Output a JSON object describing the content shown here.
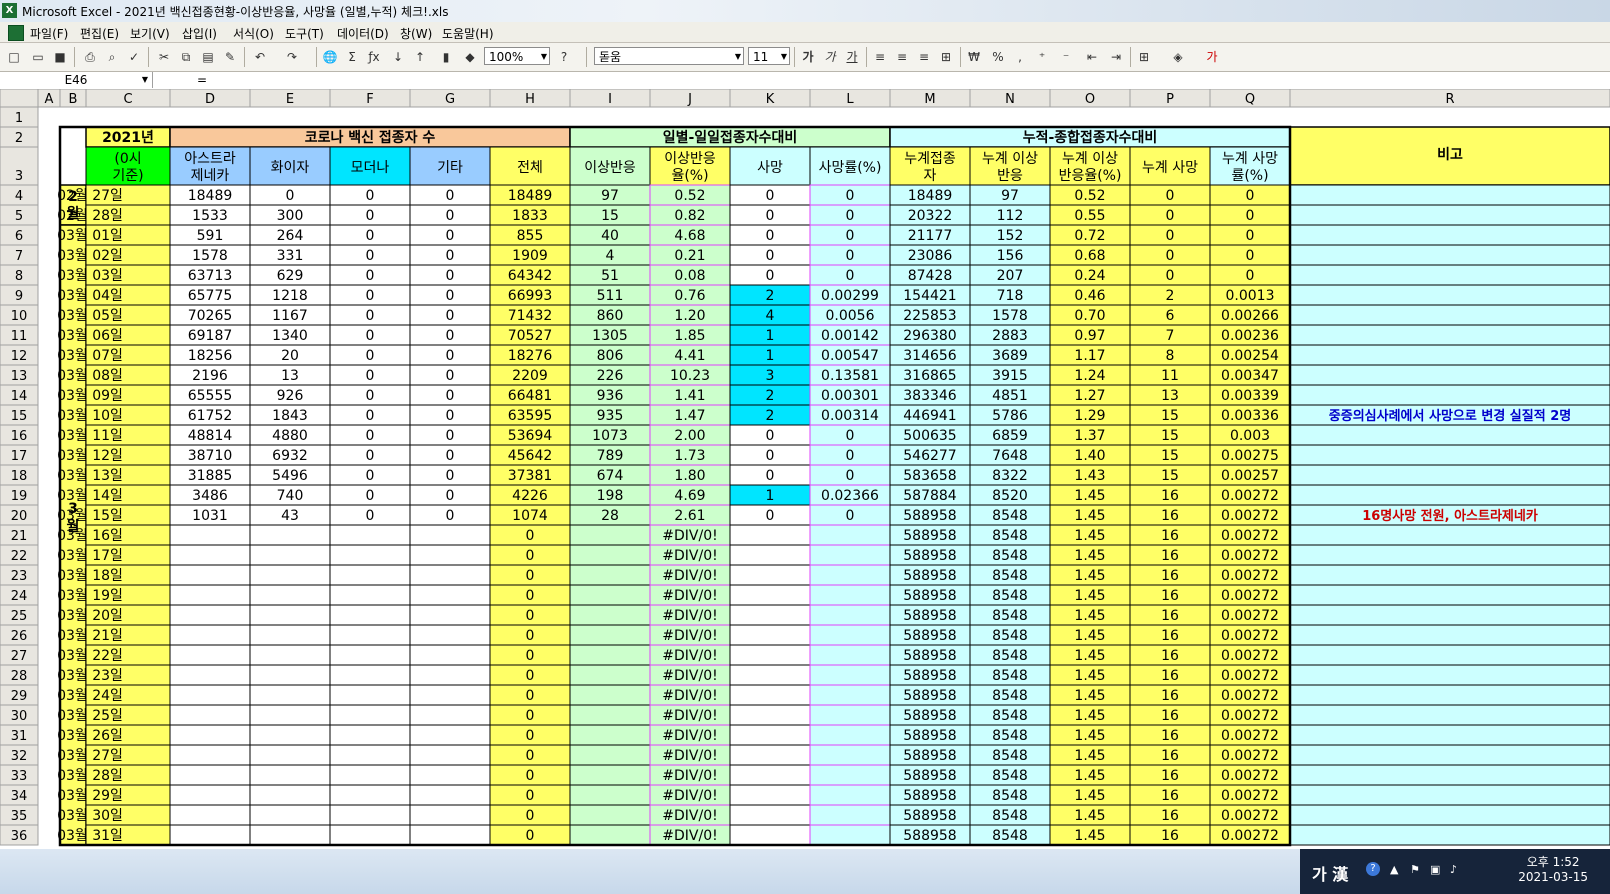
{
  "window": {
    "title": "Microsoft Excel - 2021년 백신접종현황-이상반응율, 사망율 (일별,누적) 체크!.xls"
  },
  "menu": [
    "파일(F)",
    "편집(E)",
    "보기(V)",
    "삽입(I)",
    "서식(O)",
    "도구(T)",
    "데이터(D)",
    "창(W)",
    "도움말(H)"
  ],
  "toolbar": {
    "zoom": "100%",
    "font": "돋움",
    "size": "11"
  },
  "formula_bar": {
    "cell_ref": "E46",
    "equals": "="
  },
  "columns": [
    "A",
    "B",
    "C",
    "D",
    "E",
    "F",
    "G",
    "H",
    "I",
    "J",
    "K",
    "L",
    "M",
    "N",
    "O",
    "P",
    "Q",
    "R"
  ],
  "headers": {
    "year": "2021년",
    "base": "(0시 기준)",
    "group1": "코로나 백신 접종자 수",
    "group2": "일별-일일접종자수대비",
    "group3": "누적-종합접종자수대비",
    "astra": "아스트라 제네카",
    "pfizer": "화이자",
    "moderna": "모더나",
    "other": "기타",
    "total": "전체",
    "adverse": "이상반응",
    "adverse_rate": "이상반응 율(%)",
    "death": "사망",
    "death_rate": "사망률(%)",
    "cum_total": "누계접종 자",
    "cum_adverse": "누계 이상 반응",
    "cum_adverse_rate": "누계 이상 반응율(%)",
    "cum_death": "누계 사망",
    "cum_death_rate": "누계 사망 률(%)",
    "note": "비고"
  },
  "months": {
    "feb": "2월",
    "mar": "3월"
  },
  "rows": [
    [
      "02월 27일",
      "18489",
      "0",
      "0",
      "0",
      "18489",
      "97",
      "0.52",
      "0",
      "0",
      "18489",
      "97",
      "0.52",
      "0",
      "0",
      ""
    ],
    [
      "02월 28일",
      "1533",
      "300",
      "0",
      "0",
      "1833",
      "15",
      "0.82",
      "0",
      "0",
      "20322",
      "112",
      "0.55",
      "0",
      "0",
      ""
    ],
    [
      "03월 01일",
      "591",
      "264",
      "0",
      "0",
      "855",
      "40",
      "4.68",
      "0",
      "0",
      "21177",
      "152",
      "0.72",
      "0",
      "0",
      ""
    ],
    [
      "03월 02일",
      "1578",
      "331",
      "0",
      "0",
      "1909",
      "4",
      "0.21",
      "0",
      "0",
      "23086",
      "156",
      "0.68",
      "0",
      "0",
      ""
    ],
    [
      "03월 03일",
      "63713",
      "629",
      "0",
      "0",
      "64342",
      "51",
      "0.08",
      "0",
      "0",
      "87428",
      "207",
      "0.24",
      "0",
      "0",
      ""
    ],
    [
      "03월 04일",
      "65775",
      "1218",
      "0",
      "0",
      "66993",
      "511",
      "0.76",
      "2",
      "0.00299",
      "154421",
      "718",
      "0.46",
      "2",
      "0.0013",
      ""
    ],
    [
      "03월 05일",
      "70265",
      "1167",
      "0",
      "0",
      "71432",
      "860",
      "1.20",
      "4",
      "0.0056",
      "225853",
      "1578",
      "0.70",
      "6",
      "0.00266",
      ""
    ],
    [
      "03월 06일",
      "69187",
      "1340",
      "0",
      "0",
      "70527",
      "1305",
      "1.85",
      "1",
      "0.00142",
      "296380",
      "2883",
      "0.97",
      "7",
      "0.00236",
      ""
    ],
    [
      "03월 07일",
      "18256",
      "20",
      "0",
      "0",
      "18276",
      "806",
      "4.41",
      "1",
      "0.00547",
      "314656",
      "3689",
      "1.17",
      "8",
      "0.00254",
      ""
    ],
    [
      "03월 08일",
      "2196",
      "13",
      "0",
      "0",
      "2209",
      "226",
      "10.23",
      "3",
      "0.13581",
      "316865",
      "3915",
      "1.24",
      "11",
      "0.00347",
      ""
    ],
    [
      "03월 09일",
      "65555",
      "926",
      "0",
      "0",
      "66481",
      "936",
      "1.41",
      "2",
      "0.00301",
      "383346",
      "4851",
      "1.27",
      "13",
      "0.00339",
      ""
    ],
    [
      "03월 10일",
      "61752",
      "1843",
      "0",
      "0",
      "63595",
      "935",
      "1.47",
      "2",
      "0.00314",
      "446941",
      "5786",
      "1.29",
      "15",
      "0.00336",
      "중증의심사례에서 사망으로 변경 실질적 2명"
    ],
    [
      "03월 11일",
      "48814",
      "4880",
      "0",
      "0",
      "53694",
      "1073",
      "2.00",
      "0",
      "0",
      "500635",
      "6859",
      "1.37",
      "15",
      "0.003",
      ""
    ],
    [
      "03월 12일",
      "38710",
      "6932",
      "0",
      "0",
      "45642",
      "789",
      "1.73",
      "0",
      "0",
      "546277",
      "7648",
      "1.40",
      "15",
      "0.00275",
      ""
    ],
    [
      "03월 13일",
      "31885",
      "5496",
      "0",
      "0",
      "37381",
      "674",
      "1.80",
      "0",
      "0",
      "583658",
      "8322",
      "1.43",
      "15",
      "0.00257",
      ""
    ],
    [
      "03월 14일",
      "3486",
      "740",
      "0",
      "0",
      "4226",
      "198",
      "4.69",
      "1",
      "0.02366",
      "587884",
      "8520",
      "1.45",
      "16",
      "0.00272",
      ""
    ],
    [
      "03월 15일",
      "1031",
      "43",
      "0",
      "0",
      "1074",
      "28",
      "2.61",
      "0",
      "0",
      "588958",
      "8548",
      "1.45",
      "16",
      "0.00272",
      "16명사망 전원, 아스트라제네카"
    ],
    [
      "03월 16일",
      "",
      "",
      "",
      "",
      "0",
      "",
      "#DIV/0!",
      "",
      "",
      "588958",
      "8548",
      "1.45",
      "16",
      "0.00272",
      ""
    ],
    [
      "03월 17일",
      "",
      "",
      "",
      "",
      "0",
      "",
      "#DIV/0!",
      "",
      "",
      "588958",
      "8548",
      "1.45",
      "16",
      "0.00272",
      ""
    ],
    [
      "03월 18일",
      "",
      "",
      "",
      "",
      "0",
      "",
      "#DIV/0!",
      "",
      "",
      "588958",
      "8548",
      "1.45",
      "16",
      "0.00272",
      ""
    ],
    [
      "03월 19일",
      "",
      "",
      "",
      "",
      "0",
      "",
      "#DIV/0!",
      "",
      "",
      "588958",
      "8548",
      "1.45",
      "16",
      "0.00272",
      ""
    ],
    [
      "03월 20일",
      "",
      "",
      "",
      "",
      "0",
      "",
      "#DIV/0!",
      "",
      "",
      "588958",
      "8548",
      "1.45",
      "16",
      "0.00272",
      ""
    ],
    [
      "03월 21일",
      "",
      "",
      "",
      "",
      "0",
      "",
      "#DIV/0!",
      "",
      "",
      "588958",
      "8548",
      "1.45",
      "16",
      "0.00272",
      ""
    ],
    [
      "03월 22일",
      "",
      "",
      "",
      "",
      "0",
      "",
      "#DIV/0!",
      "",
      "",
      "588958",
      "8548",
      "1.45",
      "16",
      "0.00272",
      ""
    ],
    [
      "03월 23일",
      "",
      "",
      "",
      "",
      "0",
      "",
      "#DIV/0!",
      "",
      "",
      "588958",
      "8548",
      "1.45",
      "16",
      "0.00272",
      ""
    ],
    [
      "03월 24일",
      "",
      "",
      "",
      "",
      "0",
      "",
      "#DIV/0!",
      "",
      "",
      "588958",
      "8548",
      "1.45",
      "16",
      "0.00272",
      ""
    ],
    [
      "03월 25일",
      "",
      "",
      "",
      "",
      "0",
      "",
      "#DIV/0!",
      "",
      "",
      "588958",
      "8548",
      "1.45",
      "16",
      "0.00272",
      ""
    ],
    [
      "03월 26일",
      "",
      "",
      "",
      "",
      "0",
      "",
      "#DIV/0!",
      "",
      "",
      "588958",
      "8548",
      "1.45",
      "16",
      "0.00272",
      ""
    ],
    [
      "03월 27일",
      "",
      "",
      "",
      "",
      "0",
      "",
      "#DIV/0!",
      "",
      "",
      "588958",
      "8548",
      "1.45",
      "16",
      "0.00272",
      ""
    ],
    [
      "03월 28일",
      "",
      "",
      "",
      "",
      "0",
      "",
      "#DIV/0!",
      "",
      "",
      "588958",
      "8548",
      "1.45",
      "16",
      "0.00272",
      ""
    ],
    [
      "03월 29일",
      "",
      "",
      "",
      "",
      "0",
      "",
      "#DIV/0!",
      "",
      "",
      "588958",
      "8548",
      "1.45",
      "16",
      "0.00272",
      ""
    ],
    [
      "03월 30일",
      "",
      "",
      "",
      "",
      "0",
      "",
      "#DIV/0!",
      "",
      "",
      "588958",
      "8548",
      "1.45",
      "16",
      "0.00272",
      ""
    ],
    [
      "03월 31일",
      "",
      "",
      "",
      "",
      "0",
      "",
      "#DIV/0!",
      "",
      "",
      "588958",
      "8548",
      "1.45",
      "16",
      "0.00272",
      ""
    ]
  ],
  "colors": {
    "yellow": "#ffff66",
    "orange": "#f9c89b",
    "green": "#ccffcc",
    "cyan": "#ccffff",
    "aqua": "#00e5ff",
    "purple": "#99ccff",
    "lime": "#00ff00",
    "blue_note": "#0000cc",
    "red_note": "#cc0000",
    "magenta": "#e040fb"
  },
  "taskbar": {
    "ime": "가 漢",
    "time": "오후 1:52",
    "date": "2021-03-15"
  }
}
